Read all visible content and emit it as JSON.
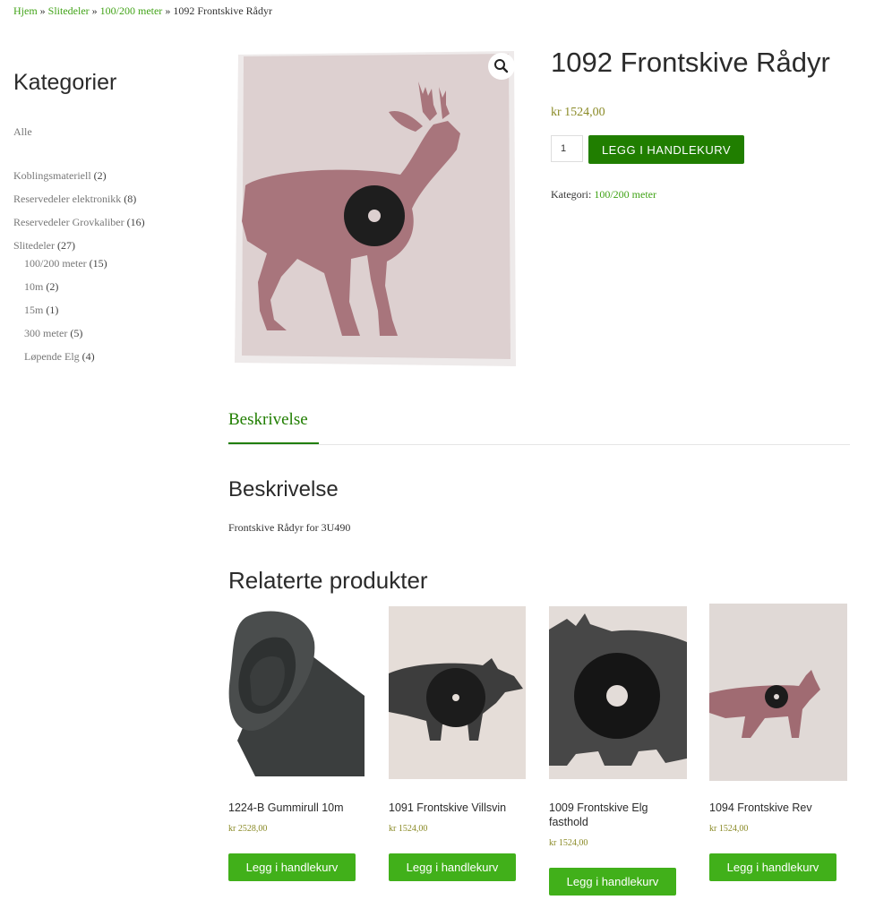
{
  "breadcrumb": {
    "items": [
      "Hjem",
      "Slitedeler",
      "100/200 meter"
    ],
    "sep": "»",
    "current": "1092 Frontskive Rådyr"
  },
  "sidebar": {
    "title": "Kategorier",
    "all": "Alle",
    "categories": [
      {
        "label": "Koblingsmateriell",
        "count": "(2)"
      },
      {
        "label": "Reservedeler elektronikk",
        "count": "(8)"
      },
      {
        "label": "Reservedeler Grovkaliber",
        "count": "(16)"
      },
      {
        "label": "Slitedeler",
        "count": "(27)"
      },
      {
        "label": "100/200 meter",
        "count": "(15)"
      },
      {
        "label": "10m",
        "count": "(2)"
      },
      {
        "label": "15m",
        "count": "(1)"
      },
      {
        "label": "300 meter",
        "count": "(5)"
      },
      {
        "label": "Løpende Elg",
        "count": "(4)"
      }
    ]
  },
  "product": {
    "title": "1092 Frontskive Rådyr",
    "price": "kr 1524,00",
    "quantity": "1",
    "add_label": "LEGG I HANDLEKURV",
    "meta_label": "Kategori:",
    "meta_value": "100/200 meter",
    "zoom_icon": "magnifier-icon"
  },
  "tabs": {
    "description": "Beskrivelse"
  },
  "description": {
    "heading": "Beskrivelse",
    "text": "Frontskive Rådyr for 3U490"
  },
  "related": {
    "heading": "Relaterte produkter",
    "button_label": "Legg i handlekurv",
    "items": [
      {
        "name": "1224-B Gummirull 10m",
        "price": "kr 2528,00"
      },
      {
        "name": "1091 Frontskive Villsvin",
        "price": "kr 1524,00"
      },
      {
        "name": "1009 Frontskive Elg fasthold",
        "price": "kr 1524,00"
      },
      {
        "name": "1094 Frontskive Rev",
        "price": "kr 1524,00"
      }
    ]
  },
  "colors": {
    "accent_green": "#41a317",
    "button_dark_green": "#207e00",
    "button_green": "#41b01a",
    "price_color": "#8a8a26"
  }
}
